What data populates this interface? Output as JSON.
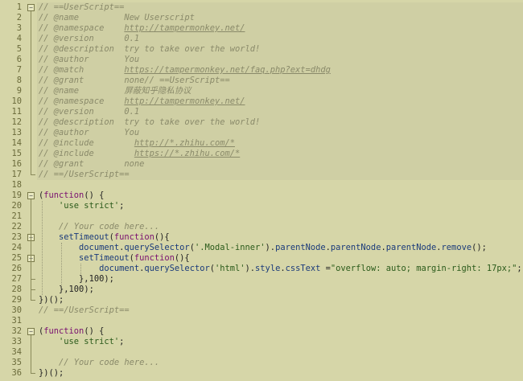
{
  "lines": [
    "// ==UserScript==",
    "// @name         New Userscript",
    "// @namespace    http://tampermonkey.net/",
    "// @version      0.1",
    "// @description  try to take over the world!",
    "// @author       You",
    "// @match        https://tampermonkey.net/faq.php?ext=dhdg",
    "// @grant        none// ==UserScript==",
    "// @name         屏蔽知乎隐私协议",
    "// @namespace    http://tampermonkey.net/",
    "// @version      0.1",
    "// @description  try to take over the world!",
    "// @author       You",
    "// @include        http://*.zhihu.com/*",
    "// @include        https://*.zhihu.com/*",
    "// @grant        none",
    "// ==/UserScript==",
    "",
    "(function() {",
    "    'use strict';",
    "",
    "    // Your code here...",
    "    setTimeout(function(){",
    "        document.querySelector('.Modal-inner').parentNode.parentNode.parentNode.remove();",
    "        setTimeout(function(){",
    "            document.querySelector('html').style.cssText =\"overflow: auto; margin-right: 17px;\";",
    "        },100);",
    "    },100);",
    "})();",
    "// ==/UserScript==",
    "",
    "(function() {",
    "    'use strict';",
    "",
    "    // Your code here...",
    "})();"
  ],
  "line_numbers": [
    "1",
    "2",
    "3",
    "4",
    "5",
    "6",
    "7",
    "8",
    "9",
    "10",
    "11",
    "12",
    "13",
    "14",
    "15",
    "16",
    "17",
    "18",
    "19",
    "20",
    "21",
    "22",
    "23",
    "24",
    "25",
    "26",
    "27",
    "28",
    "29",
    "30",
    "31",
    "32",
    "33",
    "34",
    "35",
    "36"
  ],
  "fold_markers": [
    "−",
    "−",
    "−",
    "−",
    "−"
  ],
  "colors": {
    "background": "#d6d6a8",
    "comment": "#8a8a6a",
    "keyword": "#7a1070",
    "string": "#2a5a1a",
    "identifier": "#1a3a7a"
  }
}
